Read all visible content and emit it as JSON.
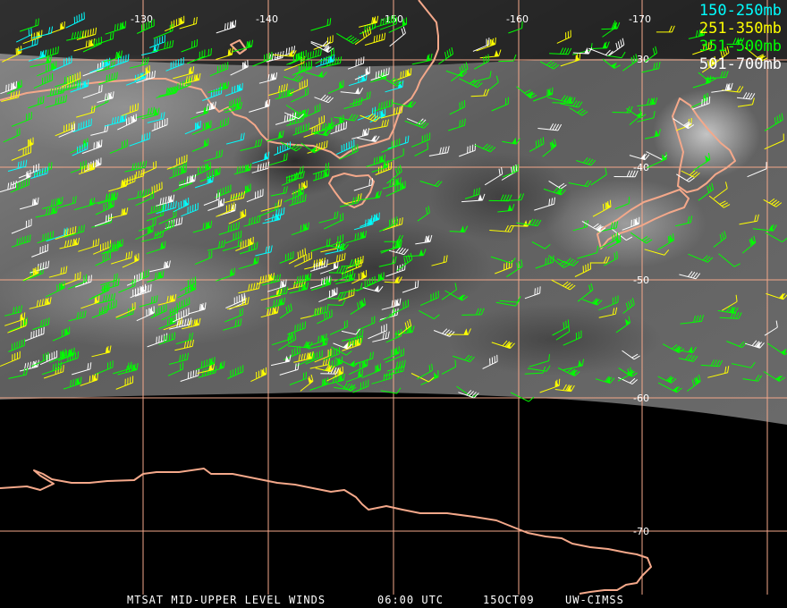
{
  "map": {
    "longitude_labels": [
      "-130",
      "-140",
      "-150",
      "-160",
      "-170"
    ],
    "latitude_labels": [
      "-30",
      "-40",
      "-50",
      "-60",
      "-70"
    ]
  },
  "legend": [
    {
      "label": "150-250mb",
      "color": "#00ffff"
    },
    {
      "label": "251-350mb",
      "color": "#ffff00"
    },
    {
      "label": "351-500mb",
      "color": "#00ff00"
    },
    {
      "label": "501-700mb",
      "color": "#ffffff"
    }
  ],
  "footer": {
    "product": "MTSAT MID-UPPER LEVEL WINDS",
    "time": "06:00 UTC",
    "date": "15OCT09",
    "source": "UW-CIMSS"
  },
  "colors": {
    "grid": "#f4a88a",
    "coast": "#f4a88a",
    "background": "#000000"
  },
  "icons": [
    "wind-barb-icon"
  ]
}
